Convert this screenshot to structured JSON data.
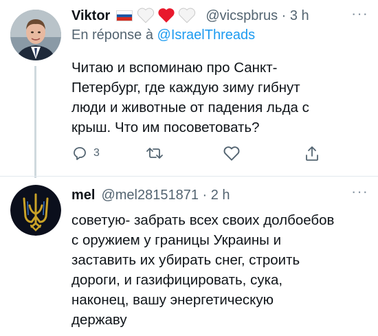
{
  "tweets": [
    {
      "display_name": "Viktor",
      "handle_line": "@vicspbrus · 3 h",
      "reply_to_prefix": "En réponse à ",
      "reply_to_handle": "@IsraelThreads",
      "lines": [
        "Читаю и вспоминаю про Санкт-",
        "Петербург, где каждую зиму гибнут",
        "люди и животные от падения льда с",
        "крыш. Что им посоветовать?"
      ],
      "reply_count": "3",
      "hearts": [
        "white",
        "red",
        "white"
      ],
      "icons": [
        "russian-flag",
        "reply-icon",
        "retweet-icon",
        "like-icon",
        "share-icon",
        "more-icon"
      ]
    },
    {
      "display_name": "mel",
      "handle_line": "@mel28151871 · 2 h",
      "lines": [
        "советую- забрать всех своих долбоебов",
        "с оружием у границы Украины и",
        "заставить их убирать снег, строить",
        "дороги, и газифицировать, сука,",
        "наконец, вашу энергетическую",
        "державу"
      ],
      "icons": [
        "ukrainian-trident-avatar",
        "more-icon"
      ]
    }
  ],
  "colors": {
    "text": "#0f1419",
    "secondary": "#536471",
    "link": "#1d9bf0",
    "thread_line": "#cfd9de",
    "heart_red": "#e8192c",
    "trident_gold": "#c9a227"
  }
}
